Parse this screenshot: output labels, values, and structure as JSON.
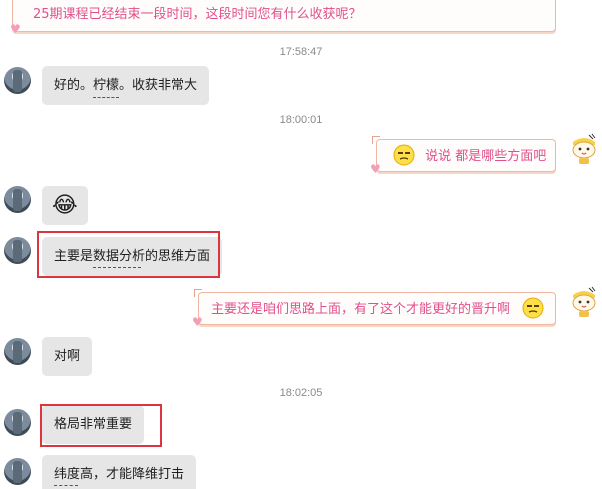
{
  "messages": {
    "m0": {
      "text": "25期课程已经结束一段时间，这段时间您有什么收获呢？"
    },
    "t1": "17:58:47",
    "m1": {
      "text": "好的。柠檬。收获非常大"
    },
    "t2": "18:00:01",
    "m2": {
      "text": "说说 都是哪些方面吧"
    },
    "m3": {
      "emoji": "😂"
    },
    "m4": {
      "text": "主要是数据分析的思维方面"
    },
    "m5": {
      "text": "主要还是咱们思路上面，有了这个才能更好的晋升啊"
    },
    "m6": {
      "text": "对啊"
    },
    "t3": "18:02:05",
    "m7": {
      "text": "格局非常重要"
    },
    "m8": {
      "text": "纬度高，才能降维打击"
    }
  },
  "colors": {
    "agent_text": "#e0508c",
    "agent_border": "#f0b7a3",
    "user_bubble": "#e6e6e6",
    "highlight_box": "#d9363e",
    "timestamp": "#8a8a8a"
  },
  "icons": {
    "smiley": "smiley-face-icon",
    "heart": "heart-icon",
    "user_avatar": "user-avatar",
    "agent_avatar": "mascot-avatar"
  }
}
